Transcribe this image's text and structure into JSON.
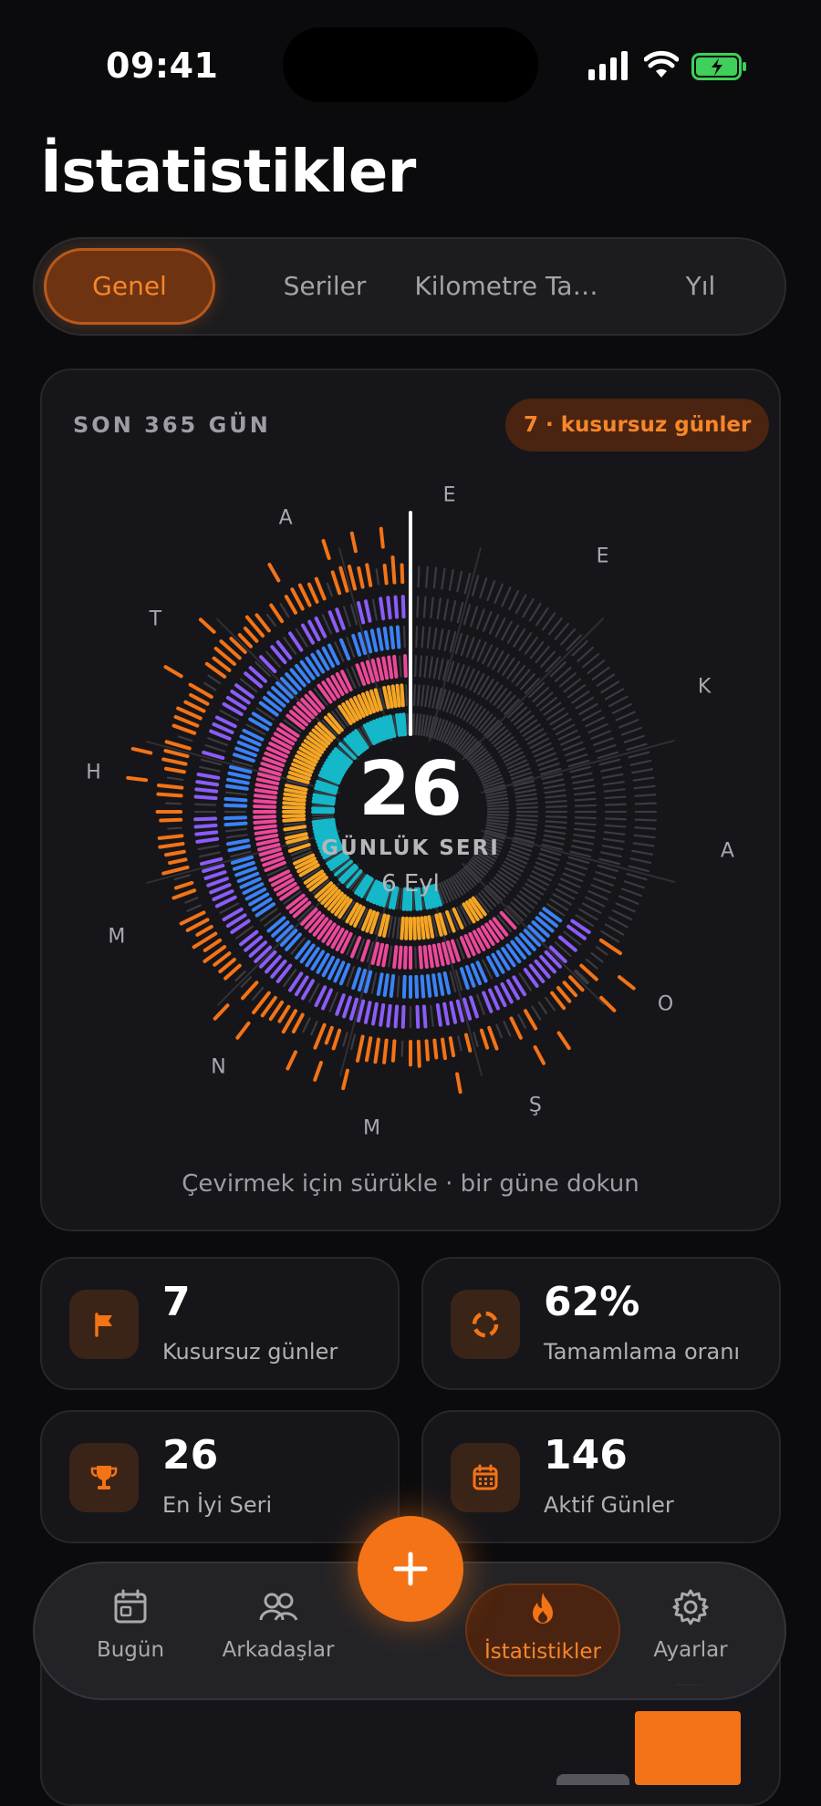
{
  "status": {
    "time": "09:41"
  },
  "page": {
    "title": "İstatistikler"
  },
  "tabs": [
    {
      "label": "Genel",
      "active": true
    },
    {
      "label": "Seriler",
      "active": false
    },
    {
      "label": "Kilometre Ta…",
      "active": false
    },
    {
      "label": "Yıl",
      "active": false
    }
  ],
  "ring_card": {
    "header": "SON 365 GÜN",
    "badge": "7 · kusursuz günler",
    "streak_value": "26",
    "streak_label": "GÜNLÜK SERI",
    "streak_date": "6 Eyl",
    "hint": "Çevirmek için sürükle · bir güne dokun",
    "month_labels": [
      "E",
      "E",
      "K",
      "A",
      "O",
      "Ş",
      "M",
      "N",
      "M",
      "H",
      "T",
      "A"
    ],
    "ring_colors": [
      "#f47316",
      "#8b5cf6",
      "#3b82f6",
      "#ec4899",
      "#f5a524",
      "#14b8c8"
    ],
    "track_color": "#3a3a40"
  },
  "stats": [
    {
      "value": "7",
      "label": "Kusursuz günler",
      "icon": "flag-icon"
    },
    {
      "value": "62%",
      "label": "Tamamlama oranı",
      "icon": "progress-ring-icon"
    },
    {
      "value": "26",
      "label": "En İyi Seri",
      "icon": "trophy-icon"
    },
    {
      "value": "146",
      "label": "Aktif Günler",
      "icon": "calendar-icon"
    }
  ],
  "nav": [
    {
      "label": "Bugün",
      "icon": "calendar-icon",
      "active": false
    },
    {
      "label": "Arkadaşlar",
      "icon": "people-icon",
      "active": false
    },
    {
      "label": "İstatistikler",
      "icon": "flame-icon",
      "active": true
    },
    {
      "label": "Ayarlar",
      "icon": "gear-icon",
      "active": false
    }
  ],
  "fab": {
    "icon": "plus-icon"
  },
  "accent": "#f47316"
}
